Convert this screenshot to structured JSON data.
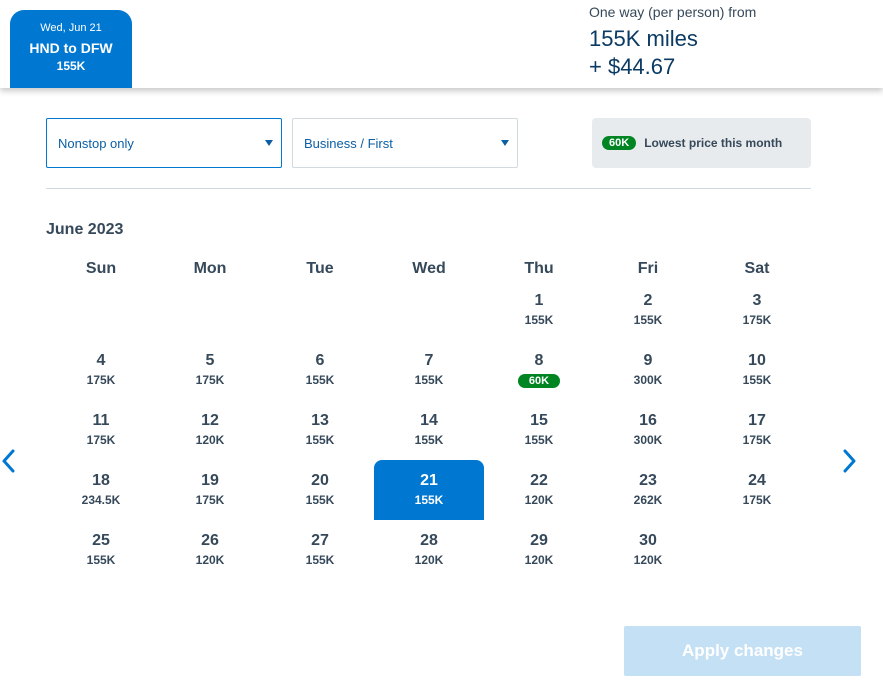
{
  "header": {
    "date": "Wed, Jun 21",
    "route": "HND to DFW",
    "price": "155K",
    "summary_label": "One way (per person) from",
    "summary_miles": "155K miles",
    "summary_cash": "+ $44.67"
  },
  "filters": {
    "stops": {
      "value": "Nonstop only"
    },
    "cabin": {
      "value": "Business / First"
    }
  },
  "legend": {
    "badge": "60K",
    "text": "Lowest price this month"
  },
  "calendar": {
    "month": "June 2023",
    "weekdays": [
      "Sun",
      "Mon",
      "Tue",
      "Wed",
      "Thu",
      "Fri",
      "Sat"
    ],
    "first_weekday_index": 4,
    "selected_day": 21,
    "lowest_day": 8,
    "days": [
      {
        "day": "1",
        "price": "155K"
      },
      {
        "day": "2",
        "price": "155K"
      },
      {
        "day": "3",
        "price": "175K"
      },
      {
        "day": "4",
        "price": "175K"
      },
      {
        "day": "5",
        "price": "175K"
      },
      {
        "day": "6",
        "price": "155K"
      },
      {
        "day": "7",
        "price": "155K"
      },
      {
        "day": "8",
        "price": "60K"
      },
      {
        "day": "9",
        "price": "300K"
      },
      {
        "day": "10",
        "price": "155K"
      },
      {
        "day": "11",
        "price": "175K"
      },
      {
        "day": "12",
        "price": "120K"
      },
      {
        "day": "13",
        "price": "155K"
      },
      {
        "day": "14",
        "price": "155K"
      },
      {
        "day": "15",
        "price": "155K"
      },
      {
        "day": "16",
        "price": "300K"
      },
      {
        "day": "17",
        "price": "175K"
      },
      {
        "day": "18",
        "price": "234.5K"
      },
      {
        "day": "19",
        "price": "175K"
      },
      {
        "day": "20",
        "price": "155K"
      },
      {
        "day": "21",
        "price": "155K"
      },
      {
        "day": "22",
        "price": "120K"
      },
      {
        "day": "23",
        "price": "262K"
      },
      {
        "day": "24",
        "price": "175K"
      },
      {
        "day": "25",
        "price": "155K"
      },
      {
        "day": "26",
        "price": "120K"
      },
      {
        "day": "27",
        "price": "155K"
      },
      {
        "day": "28",
        "price": "120K"
      },
      {
        "day": "29",
        "price": "120K"
      },
      {
        "day": "30",
        "price": "120K"
      }
    ]
  },
  "nav": {
    "prev_icon": "chevron-left-icon",
    "next_icon": "chevron-right-icon"
  },
  "actions": {
    "apply_label": "Apply changes"
  },
  "colors": {
    "accent": "#0078d2",
    "lowest_price": "#008522",
    "apply_disabled": "#c4e0f4"
  }
}
